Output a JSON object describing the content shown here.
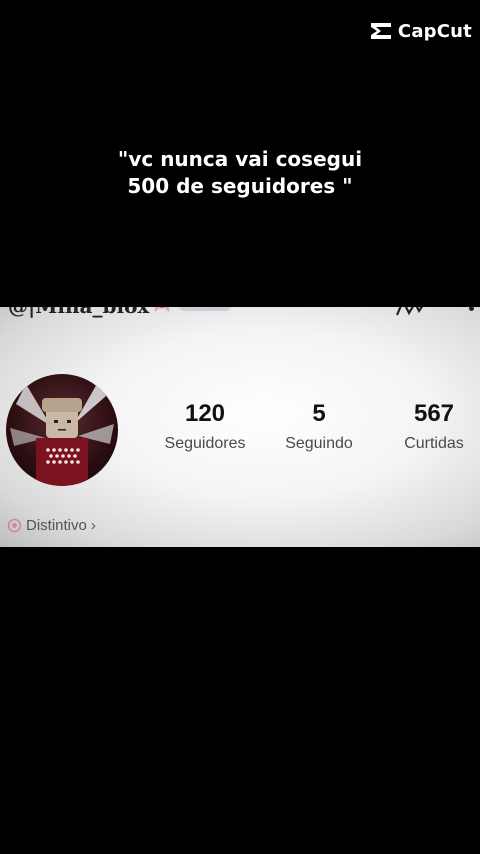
{
  "watermark": {
    "brand": "CapCut"
  },
  "caption": {
    "line1": "\"vc nunca vai cosegui",
    "line2": "500 de seguidores \""
  },
  "profile": {
    "handle": "@|Mina_blox",
    "stats": [
      {
        "value": "120",
        "label": "Seguidores"
      },
      {
        "value": "5",
        "label": "Seguindo"
      },
      {
        "value": "567",
        "label": "Curtidas"
      }
    ],
    "badge_link": {
      "label": "Distintivo",
      "chevron": "›"
    }
  },
  "icons": {
    "logo": "capcut-logo-icon",
    "handle_decoration": "bow-icon",
    "top_action": "edit-scribble-icon",
    "badge": "badge-icon"
  },
  "colors": {
    "background": "#000000",
    "panel": "#f4f4f4",
    "text_dark": "#111111",
    "label_gray": "#4a4a4a"
  }
}
